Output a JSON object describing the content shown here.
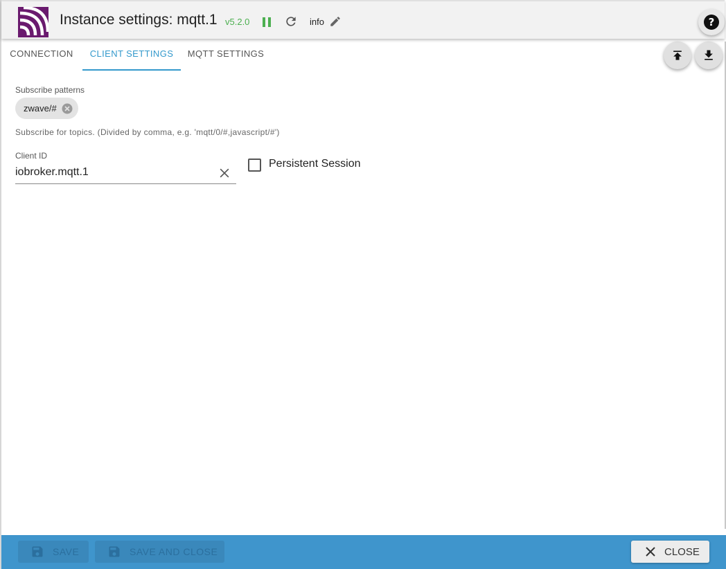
{
  "header": {
    "title": "Instance settings: mqtt.1",
    "version": "v5.2.0",
    "log_level": "info",
    "help_label": "?"
  },
  "tabs": [
    {
      "label": "CONNECTION",
      "active": false
    },
    {
      "label": "CLIENT SETTINGS",
      "active": true
    },
    {
      "label": "MQTT SETTINGS",
      "active": false
    }
  ],
  "client_settings": {
    "subscribe_label": "Subscribe patterns",
    "subscribe_chips": [
      "zwave/#"
    ],
    "subscribe_helper": "Subscribe for topics. (Divided by comma, e.g. 'mqtt/0/#,javascript/#')",
    "client_id_label": "Client ID",
    "client_id_value": "iobroker.mqtt.1",
    "persistent_session_label": "Persistent Session",
    "persistent_session_checked": false
  },
  "footer": {
    "save_label": "SAVE",
    "save_close_label": "SAVE AND CLOSE",
    "close_label": "CLOSE"
  },
  "colors": {
    "accent": "#3399cc",
    "footer_bg": "#3f95cc",
    "version": "#4caf50",
    "logo": "#6a1a6e"
  },
  "icons": [
    "mqtt-logo-icon",
    "pause-icon",
    "reload-icon",
    "edit-icon",
    "help-icon",
    "upload-icon",
    "download-icon",
    "chip-delete-icon",
    "clear-icon",
    "save-icon",
    "close-icon"
  ]
}
